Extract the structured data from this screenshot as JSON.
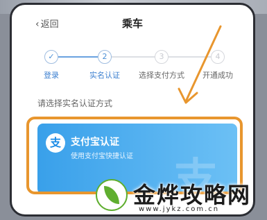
{
  "nav": {
    "back_label": "返回",
    "title": "乘车"
  },
  "steps": [
    {
      "number": "✓",
      "label": "登录",
      "state": "done"
    },
    {
      "number": "2",
      "label": "实名认证",
      "state": "current"
    },
    {
      "number": "3",
      "label": "选择支付方式",
      "state": "pending"
    },
    {
      "number": "4",
      "label": "开通成功",
      "state": "pending"
    }
  ],
  "section_title": "请选择实名认证方式",
  "auth_option": {
    "icon": "alipay-icon",
    "icon_glyph": "支",
    "title": "支付宝认证",
    "subtitle": "使用支付宝快捷认证",
    "watermark_glyph": "支"
  },
  "watermark": {
    "text": "金烨攻略网",
    "url": "www.jykz.com.cn"
  },
  "colors": {
    "accent": "#3b7fd0",
    "card_start": "#39a0ea",
    "card_end": "#6cc0f5",
    "highlight": "#e8962e"
  }
}
